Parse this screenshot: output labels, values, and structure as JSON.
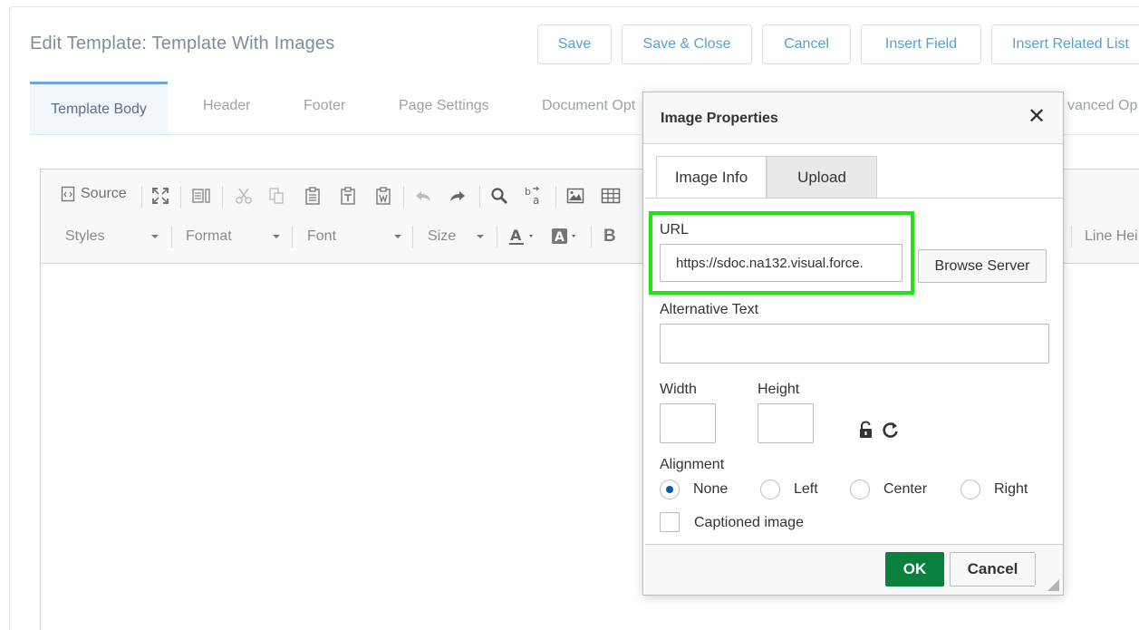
{
  "page": {
    "title": "Edit Template: Template With Images"
  },
  "header_buttons": {
    "save": "Save",
    "save_close": "Save & Close",
    "cancel": "Cancel",
    "insert_field": "Insert Field",
    "insert_related_list": "Insert Related List"
  },
  "tabs": {
    "template_body": "Template Body",
    "header": "Header",
    "footer": "Footer",
    "page_settings": "Page Settings",
    "document_options": "Document Opt",
    "advanced_options": "vanced Op"
  },
  "toolbar": {
    "source": "Source",
    "styles": "Styles",
    "format": "Format",
    "font": "Font",
    "size": "Size",
    "line_height": "Line Hei",
    "bold": "B"
  },
  "dialog": {
    "title": "Image Properties",
    "close_glyph": "✕",
    "tab_image_info": "Image Info",
    "tab_upload": "Upload",
    "url_label": "URL",
    "url_value": "https://sdoc.na132.visual.force.",
    "browse_server": "Browse Server",
    "alt_text_label": "Alternative Text",
    "alt_text_value": "",
    "width_label": "Width",
    "height_label": "Height",
    "width_value": "",
    "height_value": "",
    "alignment_label": "Alignment",
    "alignment_options": [
      "None",
      "Left",
      "Center",
      "Right"
    ],
    "alignment_selected": "None",
    "captioned_label": "Captioned image",
    "captioned_checked": false,
    "ok": "OK",
    "cancel": "Cancel"
  },
  "colors": {
    "link_blue": "#5a9fd4",
    "ok_green": "#09803e",
    "highlight_green": "#1ee60c",
    "radio_selected": "#0b5cab"
  }
}
